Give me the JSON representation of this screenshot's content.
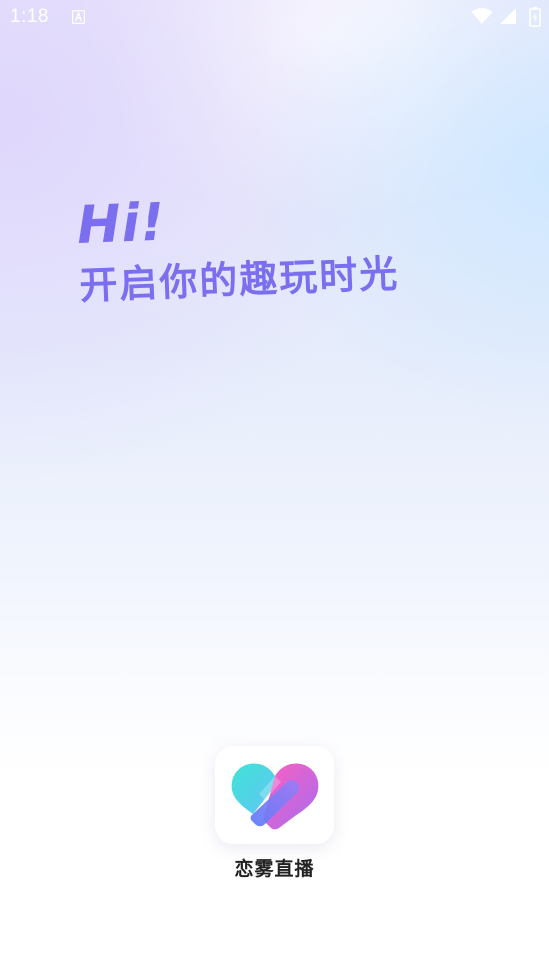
{
  "status_bar": {
    "time": "1:18",
    "app_icon": "a-letter-icon",
    "icons": [
      "wifi-icon",
      "signal-icon",
      "battery-icon"
    ]
  },
  "hero": {
    "greeting": "Hi!",
    "slogan": "开启你的趣玩时光"
  },
  "app": {
    "logo_icon": "heart-logo-icon",
    "name": "恋雾直播"
  },
  "colors": {
    "accent": "#7b6ff0",
    "logo_cyan": "#3fe3d6",
    "logo_blue": "#5c7cf7",
    "logo_pink": "#ff5fbd",
    "text_dark": "#222222"
  }
}
